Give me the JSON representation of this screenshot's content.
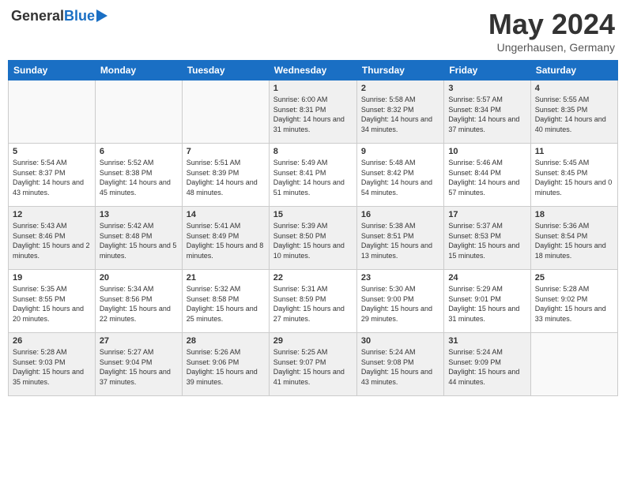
{
  "header": {
    "logo_general": "General",
    "logo_blue": "Blue",
    "month_title": "May 2024",
    "location": "Ungerhausen, Germany"
  },
  "calendar": {
    "days": [
      "Sunday",
      "Monday",
      "Tuesday",
      "Wednesday",
      "Thursday",
      "Friday",
      "Saturday"
    ],
    "rows": [
      [
        {
          "day": "",
          "empty": true
        },
        {
          "day": "",
          "empty": true
        },
        {
          "day": "",
          "empty": true
        },
        {
          "day": "1",
          "sunrise": "6:00 AM",
          "sunset": "8:31 PM",
          "daylight": "14 hours and 31 minutes."
        },
        {
          "day": "2",
          "sunrise": "5:58 AM",
          "sunset": "8:32 PM",
          "daylight": "14 hours and 34 minutes."
        },
        {
          "day": "3",
          "sunrise": "5:57 AM",
          "sunset": "8:34 PM",
          "daylight": "14 hours and 37 minutes."
        },
        {
          "day": "4",
          "sunrise": "5:55 AM",
          "sunset": "8:35 PM",
          "daylight": "14 hours and 40 minutes."
        }
      ],
      [
        {
          "day": "5",
          "sunrise": "5:54 AM",
          "sunset": "8:37 PM",
          "daylight": "14 hours and 43 minutes."
        },
        {
          "day": "6",
          "sunrise": "5:52 AM",
          "sunset": "8:38 PM",
          "daylight": "14 hours and 45 minutes."
        },
        {
          "day": "7",
          "sunrise": "5:51 AM",
          "sunset": "8:39 PM",
          "daylight": "14 hours and 48 minutes."
        },
        {
          "day": "8",
          "sunrise": "5:49 AM",
          "sunset": "8:41 PM",
          "daylight": "14 hours and 51 minutes."
        },
        {
          "day": "9",
          "sunrise": "5:48 AM",
          "sunset": "8:42 PM",
          "daylight": "14 hours and 54 minutes."
        },
        {
          "day": "10",
          "sunrise": "5:46 AM",
          "sunset": "8:44 PM",
          "daylight": "14 hours and 57 minutes."
        },
        {
          "day": "11",
          "sunrise": "5:45 AM",
          "sunset": "8:45 PM",
          "daylight": "15 hours and 0 minutes."
        }
      ],
      [
        {
          "day": "12",
          "sunrise": "5:43 AM",
          "sunset": "8:46 PM",
          "daylight": "15 hours and 2 minutes."
        },
        {
          "day": "13",
          "sunrise": "5:42 AM",
          "sunset": "8:48 PM",
          "daylight": "15 hours and 5 minutes."
        },
        {
          "day": "14",
          "sunrise": "5:41 AM",
          "sunset": "8:49 PM",
          "daylight": "15 hours and 8 minutes."
        },
        {
          "day": "15",
          "sunrise": "5:39 AM",
          "sunset": "8:50 PM",
          "daylight": "15 hours and 10 minutes."
        },
        {
          "day": "16",
          "sunrise": "5:38 AM",
          "sunset": "8:51 PM",
          "daylight": "15 hours and 13 minutes."
        },
        {
          "day": "17",
          "sunrise": "5:37 AM",
          "sunset": "8:53 PM",
          "daylight": "15 hours and 15 minutes."
        },
        {
          "day": "18",
          "sunrise": "5:36 AM",
          "sunset": "8:54 PM",
          "daylight": "15 hours and 18 minutes."
        }
      ],
      [
        {
          "day": "19",
          "sunrise": "5:35 AM",
          "sunset": "8:55 PM",
          "daylight": "15 hours and 20 minutes."
        },
        {
          "day": "20",
          "sunrise": "5:34 AM",
          "sunset": "8:56 PM",
          "daylight": "15 hours and 22 minutes."
        },
        {
          "day": "21",
          "sunrise": "5:32 AM",
          "sunset": "8:58 PM",
          "daylight": "15 hours and 25 minutes."
        },
        {
          "day": "22",
          "sunrise": "5:31 AM",
          "sunset": "8:59 PM",
          "daylight": "15 hours and 27 minutes."
        },
        {
          "day": "23",
          "sunrise": "5:30 AM",
          "sunset": "9:00 PM",
          "daylight": "15 hours and 29 minutes."
        },
        {
          "day": "24",
          "sunrise": "5:29 AM",
          "sunset": "9:01 PM",
          "daylight": "15 hours and 31 minutes."
        },
        {
          "day": "25",
          "sunrise": "5:28 AM",
          "sunset": "9:02 PM",
          "daylight": "15 hours and 33 minutes."
        }
      ],
      [
        {
          "day": "26",
          "sunrise": "5:28 AM",
          "sunset": "9:03 PM",
          "daylight": "15 hours and 35 minutes."
        },
        {
          "day": "27",
          "sunrise": "5:27 AM",
          "sunset": "9:04 PM",
          "daylight": "15 hours and 37 minutes."
        },
        {
          "day": "28",
          "sunrise": "5:26 AM",
          "sunset": "9:06 PM",
          "daylight": "15 hours and 39 minutes."
        },
        {
          "day": "29",
          "sunrise": "5:25 AM",
          "sunset": "9:07 PM",
          "daylight": "15 hours and 41 minutes."
        },
        {
          "day": "30",
          "sunrise": "5:24 AM",
          "sunset": "9:08 PM",
          "daylight": "15 hours and 43 minutes."
        },
        {
          "day": "31",
          "sunrise": "5:24 AM",
          "sunset": "9:09 PM",
          "daylight": "15 hours and 44 minutes."
        },
        {
          "day": "",
          "empty": true
        }
      ]
    ]
  }
}
